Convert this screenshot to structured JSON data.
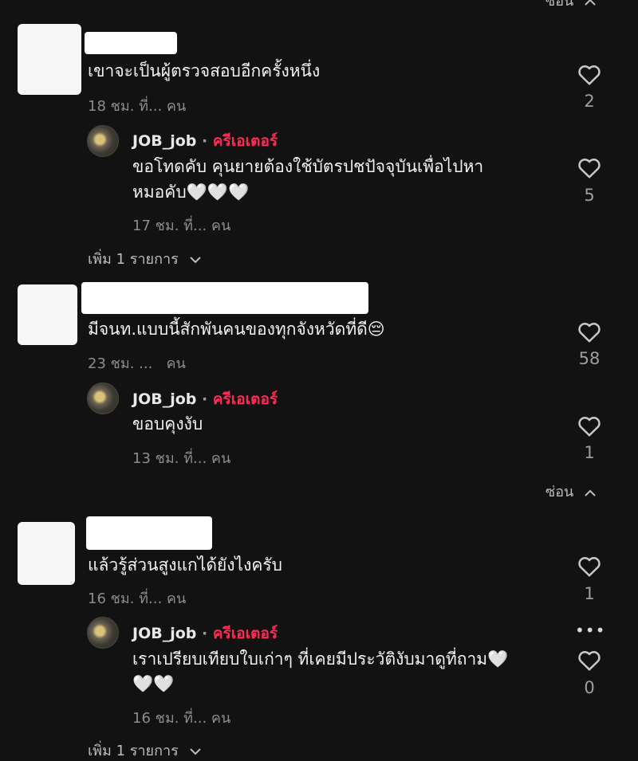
{
  "top_hide_label": "ซ่อน",
  "threads": [
    {
      "comment_text": "เขาจะเป็นผู้ตรวจสอบอีกครั้งหนึ่ง",
      "meta": "18 ชม. ที่... คน",
      "likes": "2",
      "reply": {
        "username": "JOB_job",
        "separator": "·",
        "creator_label": "ครีเอเตอร์",
        "text_lines": [
          "ขอโทดคับ คุนยายต้องใช้บัตรปชปัจจุบันเพื่อไปหา",
          "หมอคับ🤍🤍🤍"
        ],
        "meta": "17 ชม. ที่... คน",
        "likes": "5"
      },
      "more_label": "เพิ่ม 1 รายการ"
    },
    {
      "comment_text": "มีจนท.แบบนี้สักพันคนของทุกจังหวัดที่ดี😔",
      "meta": "23 ชม. ...   คน",
      "likes": "58",
      "reply": {
        "username": "JOB_job",
        "separator": "·",
        "creator_label": "ครีเอเตอร์",
        "text_lines": [
          "ขอบคุงงับ"
        ],
        "meta": "13 ชม. ที่... คน",
        "likes": "1"
      },
      "hide_label": "ซ่อน"
    },
    {
      "comment_text": "แล้วรู้ส่วนสูงแกได้ยังไงครับ",
      "meta": "16 ชม. ที่... คน",
      "likes": "1",
      "reply": {
        "username": "JOB_job",
        "separator": "·",
        "creator_label": "ครีเอเตอร์",
        "text_lines": [
          "เราเปรียบเทียบใบเก่าๆ ที่เคยมีประวัติงับมาดูที่ถาม🤍",
          "🤍🤍"
        ],
        "meta": "16 ชม. ที่... คน",
        "likes": "0",
        "more_options": "•••"
      },
      "more_label": "เพิ่ม 1 รายการ"
    }
  ],
  "colors": {
    "background": "#121212",
    "creator": "#fe2c55",
    "meta": "#8c8c8c"
  }
}
